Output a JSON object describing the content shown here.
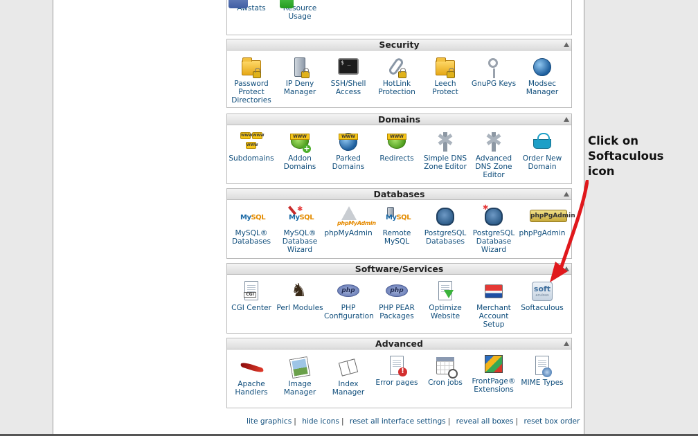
{
  "top_partial": {
    "items": [
      {
        "icon": "awstats-icon",
        "label": "Awstats"
      },
      {
        "icon": "resource-usage-icon",
        "label": "Resource Usage"
      }
    ]
  },
  "sections": [
    {
      "title": "Security",
      "items": [
        {
          "icon": "locked-folder-icon",
          "label": "Password Protect Directories"
        },
        {
          "icon": "server-lock-icon",
          "label": "IP Deny Manager"
        },
        {
          "icon": "terminal-icon",
          "label": "SSH/Shell Access"
        },
        {
          "icon": "chain-lock-icon",
          "label": "HotLink Protection"
        },
        {
          "icon": "locked-folder-icon",
          "label": "Leech Protect"
        },
        {
          "icon": "keys-icon",
          "label": "GnuPG Keys"
        },
        {
          "icon": "globe-shield-icon",
          "label": "Modsec Manager"
        }
      ]
    },
    {
      "title": "Domains",
      "items": [
        {
          "icon": "www-globes-icon",
          "label": "Subdomains"
        },
        {
          "icon": "www-add-icon",
          "label": "Addon Domains"
        },
        {
          "icon": "www-parked-icon",
          "label": "Parked Domains"
        },
        {
          "icon": "www-redirect-icon",
          "label": "Redirects"
        },
        {
          "icon": "satellite-icon",
          "label": "Simple DNS Zone Editor"
        },
        {
          "icon": "satellite-icon",
          "label": "Advanced DNS Zone Editor"
        },
        {
          "icon": "basket-icon",
          "label": "Order New Domain"
        }
      ]
    },
    {
      "title": "Databases",
      "items": [
        {
          "icon": "mysql-icon",
          "label": "MySQL® Databases"
        },
        {
          "icon": "mysql-wizard-icon",
          "label": "MySQL® Database Wizard"
        },
        {
          "icon": "phpmyadmin-icon",
          "label": "phpMyAdmin"
        },
        {
          "icon": "mysql-remote-icon",
          "label": "Remote MySQL"
        },
        {
          "icon": "postgresql-icon",
          "label": "PostgreSQL Databases"
        },
        {
          "icon": "postgresql-wizard-icon",
          "label": "PostgreSQL Database Wizard"
        },
        {
          "icon": "phppgadmin-icon",
          "label": "phpPgAdmin"
        }
      ]
    },
    {
      "title": "Software/Services",
      "items": [
        {
          "icon": "cgi-document-icon",
          "label": "CGI Center"
        },
        {
          "icon": "camel-icon",
          "label": "Perl Modules"
        },
        {
          "icon": "php-icon",
          "label": "PHP Configuration"
        },
        {
          "icon": "php-icon",
          "label": "PHP PEAR Packages"
        },
        {
          "icon": "optimize-document-icon",
          "label": "Optimize Website"
        },
        {
          "icon": "credit-card-icon",
          "label": "Merchant Account Setup"
        },
        {
          "icon": "softaculous-icon",
          "label": "Softaculous"
        }
      ]
    },
    {
      "title": "Advanced",
      "items": [
        {
          "icon": "feather-icon",
          "label": "Apache Handlers"
        },
        {
          "icon": "picture-icon",
          "label": "Image Manager"
        },
        {
          "icon": "book-icon",
          "label": "Index Manager"
        },
        {
          "icon": "error-document-icon",
          "label": "Error pages"
        },
        {
          "icon": "calendar-clock-icon",
          "label": "Cron jobs"
        },
        {
          "icon": "frontpage-icon",
          "label": "FrontPage® Extensions"
        },
        {
          "icon": "mime-document-icon",
          "label": "MIME Types"
        }
      ]
    }
  ],
  "footer_links": [
    "lite graphics",
    "hide icons",
    "reset all interface settings",
    "reveal all boxes",
    "reset box order"
  ],
  "footer_separator": "|",
  "callout": {
    "lines": [
      "Click on",
      "Softaculous",
      "icon"
    ],
    "arrow_color": "#e0181c"
  },
  "icon_texts": {
    "terminal": "$ _",
    "www": "WWW",
    "mysql_a": "My",
    "mysql_b": "SQL",
    "phpmyadmin": "phpMyAdmin",
    "phppgadmin": "phpPgAdmin",
    "cgi": "CGI",
    "php": "php",
    "visa": "VISA",
    "soft": "soft",
    "softaculous_small": "aculous"
  },
  "colors": {
    "link": "#0f4d7b",
    "section_header_bg": "#dcdcdc",
    "background": "#e9e9e9"
  }
}
